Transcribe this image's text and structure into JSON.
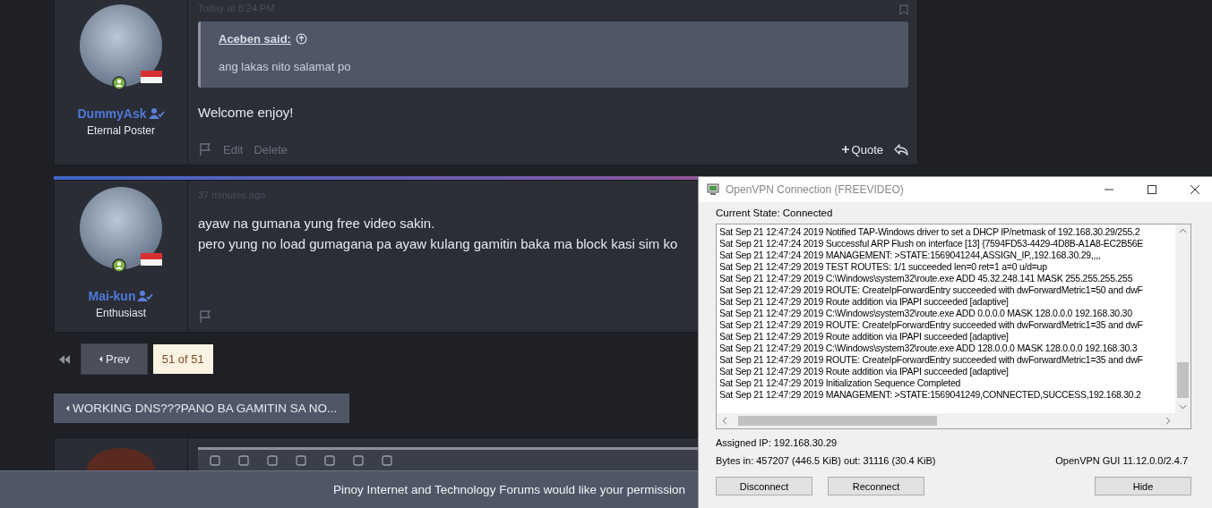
{
  "posts": [
    {
      "author": "DummyAsk",
      "role": "Eternal Poster",
      "time": "Today at 8:24 PM",
      "online": true,
      "new": false,
      "quote": {
        "author": "Aceben said:",
        "text": "ang lakas nito salamat po"
      },
      "body": [
        "Welcome enjoy!"
      ],
      "actions": [
        "Edit",
        "Delete"
      ],
      "quote_button": "Quote"
    },
    {
      "author": "Mai-kun",
      "role": "Enthusiast",
      "time": "37 minutes ago",
      "online": true,
      "new": true,
      "body": [
        "ayaw na gumana yung free video sakin.",
        "pero yung no load gumagana pa ayaw kulang gamitin baka ma block kasi sim ko"
      ]
    }
  ],
  "pagination": {
    "prev": "Prev",
    "current": "51 of 51"
  },
  "thread_nav": "WORKING DNS???PANO BA GAMITIN SA NO...",
  "notice": "Pinoy Internet and Technology Forums would like your permission",
  "vpn_window": {
    "title": "OpenVPN Connection (FREEVIDEO)",
    "state": "Current State: Connected",
    "log": [
      "Sat Sep 21 12:47:24 2019 Notified TAP-Windows driver to set a DHCP IP/netmask of 192.168.30.29/255.2",
      "Sat Sep 21 12:47:24 2019 Successful ARP Flush on interface [13] {7594FD53-4429-4D8B-A1A8-EC2B56E",
      "Sat Sep 21 12:47:24 2019 MANAGEMENT: >STATE:1569041244,ASSIGN_IP,,192.168.30.29,,,,",
      "Sat Sep 21 12:47:29 2019 TEST ROUTES: 1/1 succeeded len=0 ret=1 a=0 u/d=up",
      "Sat Sep 21 12:47:29 2019 C:\\Windows\\system32\\route.exe ADD 45.32.248.141 MASK 255.255.255.255",
      "Sat Sep 21 12:47:29 2019 ROUTE: CreateIpForwardEntry succeeded with dwForwardMetric1=50 and dwF",
      "Sat Sep 21 12:47:29 2019 Route addition via IPAPI succeeded [adaptive]",
      "Sat Sep 21 12:47:29 2019 C:\\Windows\\system32\\route.exe ADD 0.0.0.0 MASK 128.0.0.0 192.168.30.30",
      "Sat Sep 21 12:47:29 2019 ROUTE: CreateIpForwardEntry succeeded with dwForwardMetric1=35 and dwF",
      "Sat Sep 21 12:47:29 2019 Route addition via IPAPI succeeded [adaptive]",
      "Sat Sep 21 12:47:29 2019 C:\\Windows\\system32\\route.exe ADD 128.0.0.0 MASK 128.0.0.0 192.168.30.3",
      "Sat Sep 21 12:47:29 2019 ROUTE: CreateIpForwardEntry succeeded with dwForwardMetric1=35 and dwF",
      "Sat Sep 21 12:47:29 2019 Route addition via IPAPI succeeded [adaptive]",
      "Sat Sep 21 12:47:29 2019 Initialization Sequence Completed",
      "Sat Sep 21 12:47:29 2019 MANAGEMENT: >STATE:1569041249,CONNECTED,SUCCESS,192.168.30.2"
    ],
    "assigned_ip": "Assigned IP: 192.168.30.29",
    "bytes": "Bytes in: 457207 (446.5 KiB)  out: 31116 (30.4 KiB)",
    "version": "OpenVPN GUI 11.12.0.0/2.4.7",
    "buttons": [
      "Disconnect",
      "Reconnect",
      "Hide"
    ]
  }
}
